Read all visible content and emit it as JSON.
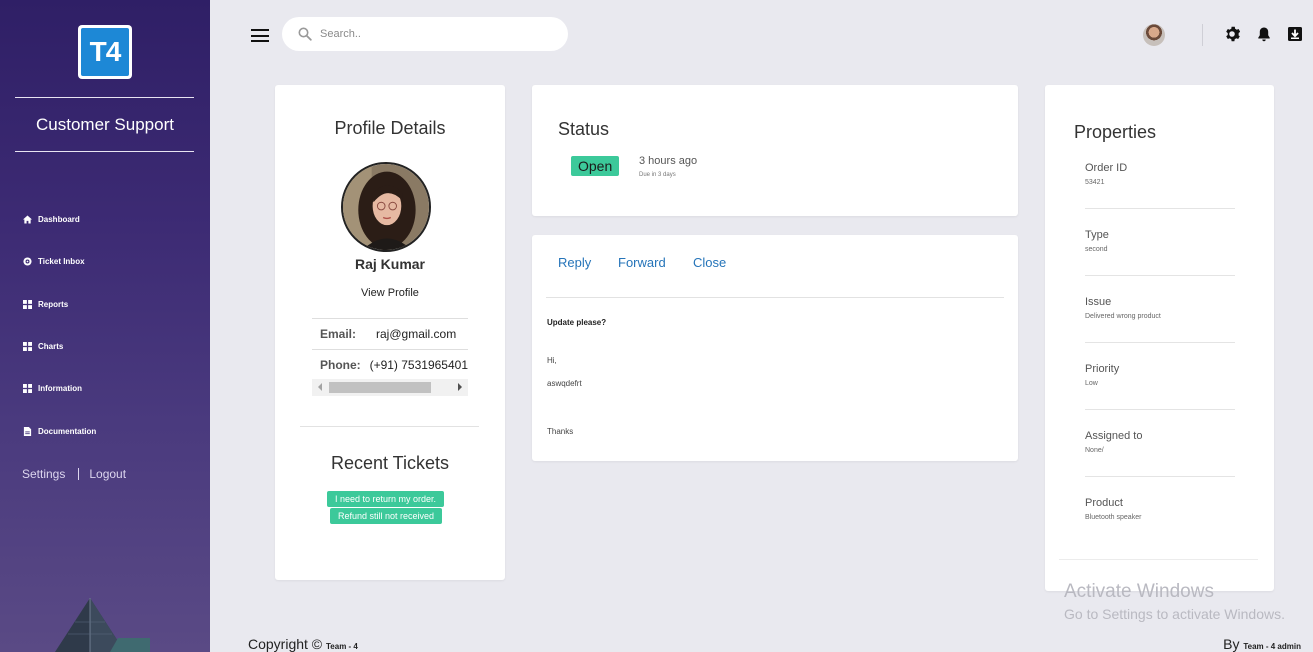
{
  "sidebar": {
    "logo_text": "T4",
    "app_title": "Customer Support",
    "items": [
      {
        "label": "Dashboard",
        "icon": "home-icon"
      },
      {
        "label": "Ticket Inbox",
        "icon": "inbox-icon"
      },
      {
        "label": "Reports",
        "icon": "grid-icon"
      },
      {
        "label": "Charts",
        "icon": "grid-icon"
      },
      {
        "label": "Information",
        "icon": "grid-icon"
      },
      {
        "label": "Documentation",
        "icon": "document-icon"
      }
    ],
    "settings_label": "Settings",
    "logout_label": "Logout"
  },
  "topbar": {
    "search_placeholder": "Search.."
  },
  "profile": {
    "title": "Profile Details",
    "name": "Raj Kumar",
    "view_profile": "View Profile",
    "email_label": "Email:",
    "email_value": "raj@gmail.com",
    "phone_label": "Phone:",
    "phone_value": "(+91) 7531965401",
    "recent_title": "Recent Tickets",
    "recent_tickets": [
      "I need to return my order.",
      "Refund still not received"
    ]
  },
  "status": {
    "title": "Status",
    "badge": "Open",
    "time": "3 hours ago",
    "due": "Due in 3 days"
  },
  "message": {
    "actions": [
      "Reply",
      "Forward",
      "Close"
    ],
    "subject": "Update please?",
    "greeting": "Hi,",
    "body": "aswqdefrt",
    "closing": "Thanks"
  },
  "properties": {
    "title": "Properties",
    "items": [
      {
        "label": "Order ID",
        "value": "53421"
      },
      {
        "label": "Type",
        "value": "second"
      },
      {
        "label": "Issue",
        "value": "Delivered wrong product"
      },
      {
        "label": "Priority",
        "value": "Low"
      },
      {
        "label": "Assigned to",
        "value": "None/"
      },
      {
        "label": "Product",
        "value": "Bluetooth speaker"
      }
    ]
  },
  "watermark": {
    "line1": "Activate Windows",
    "line2": "Go to Settings to activate Windows."
  },
  "footer": {
    "copyright": "Copyright ©",
    "team": "Team - 4",
    "by": "By",
    "admin": "Team - 4 admin"
  },
  "colors": {
    "sidebar_top": "#2f1f66",
    "accent_green": "#3cc99a",
    "link_blue": "#2574b9",
    "logo_blue": "#1d88d6"
  }
}
